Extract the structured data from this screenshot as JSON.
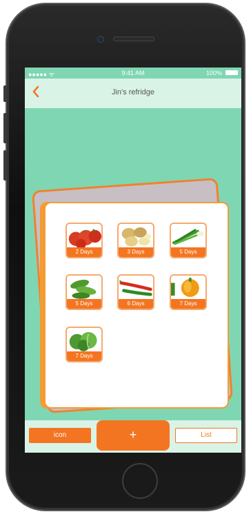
{
  "status_bar": {
    "carrier": "●●●●● ᯤ",
    "time": "9:41 AM",
    "battery": "100%"
  },
  "nav": {
    "back_icon": "chevron-left-icon",
    "title": "Jin's refridge"
  },
  "items": [
    {
      "name": "tomato",
      "days": "2 Days"
    },
    {
      "name": "potato",
      "days": "3 Days"
    },
    {
      "name": "green-onion",
      "days": "5 Days"
    },
    {
      "name": "cucumber",
      "days": "5 Days"
    },
    {
      "name": "chili",
      "days": "6 Days"
    },
    {
      "name": "bell-pepper",
      "days": "7 Days"
    },
    {
      "name": "cabbage",
      "days": "7 Days"
    }
  ],
  "toolbar": {
    "icon_label": "icon",
    "add_label": "+",
    "list_label": "List"
  },
  "colors": {
    "accent": "#f47521",
    "screen_bg": "#7fd6b3",
    "bar_bg": "#d9f3e7"
  }
}
